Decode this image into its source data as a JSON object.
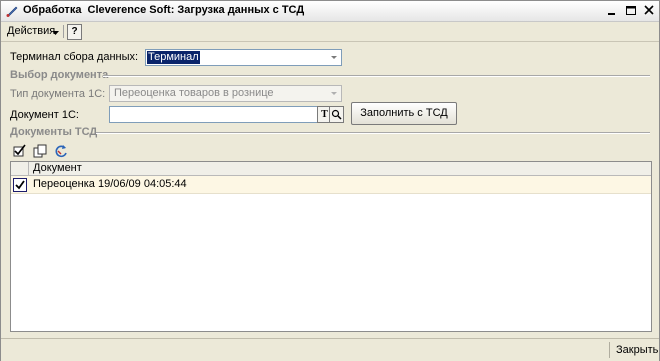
{
  "window": {
    "title": "Обработка  Cleverence Soft: Загрузка данных с ТСД"
  },
  "menu": {
    "actions_label": "Действия",
    "help_label": "?"
  },
  "terminal": {
    "label": "Терминал сбора данных:",
    "value": "Терминал"
  },
  "doc_select": {
    "section_title": "Выбор документа",
    "type_label": "Тип документа 1С:",
    "type_value": "Переоценка товаров в рознице",
    "doc_label": "Документ 1С:",
    "doc_value": "",
    "t_button": "T",
    "fill_button": "Заполнить с ТСД"
  },
  "tsd_docs": {
    "section_title": "Документы ТСД",
    "columns": [
      "Документ"
    ],
    "rows": [
      {
        "checked": true,
        "document": "Переоценка 19/06/09 04:05:44"
      }
    ]
  },
  "footer": {
    "close_label": "Закрыть"
  }
}
